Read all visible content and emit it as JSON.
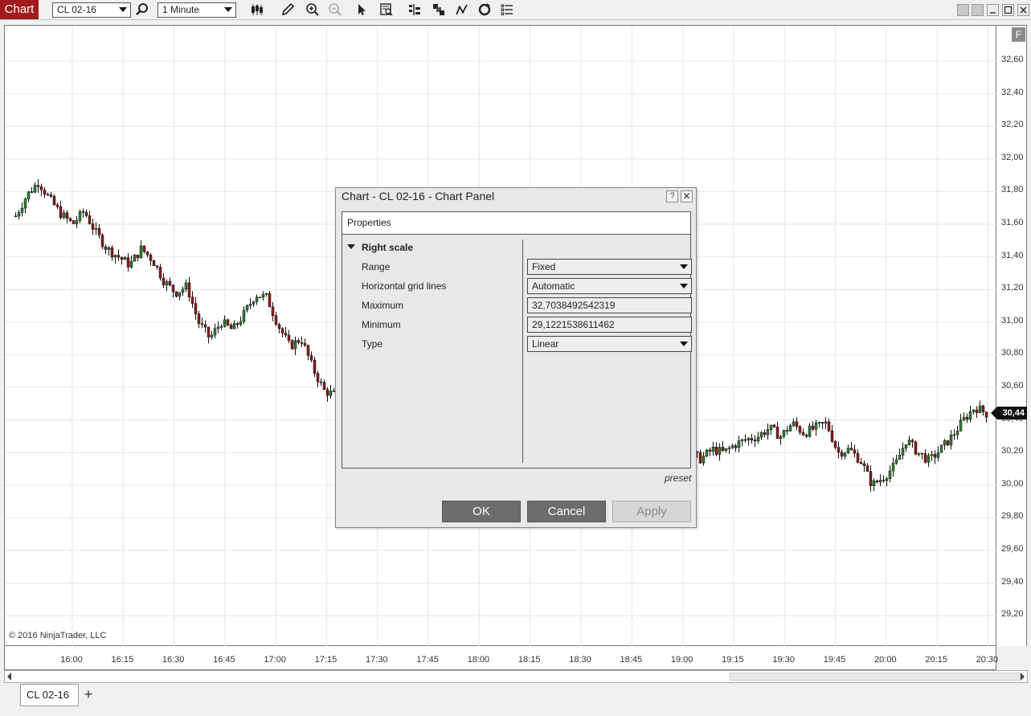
{
  "toolbar": {
    "chart_tab": "Chart",
    "instrument": "CL 02-16",
    "interval": "1 Minute"
  },
  "chart": {
    "copyright": "© 2016 NinjaTrader, LLC",
    "current_price": "30,44",
    "f_button": "F",
    "price_labels": [
      "32,60",
      "32,40",
      "32,20",
      "32,00",
      "31,80",
      "31,60",
      "31,40",
      "31,20",
      "31,00",
      "30,80",
      "30,60",
      "30,40",
      "30,20",
      "30,00",
      "29,80",
      "29,60",
      "29,40",
      "29,20"
    ],
    "time_labels": [
      "16:00",
      "16:15",
      "16:30",
      "16:45",
      "17:00",
      "17:15",
      "17:30",
      "17:45",
      "18:00",
      "18:15",
      "18:30",
      "18:45",
      "19:00",
      "19:15",
      "19:30",
      "19:45",
      "20:00",
      "20:15",
      "20:30"
    ],
    "colors": {
      "up": "#2e7d32",
      "down": "#8b1a1a",
      "wick": "#111111"
    },
    "price_path": [
      31.65,
      31.78,
      31.86,
      31.75,
      31.66,
      31.6,
      31.68,
      31.55,
      31.45,
      31.4,
      31.35,
      31.45,
      31.38,
      31.25,
      31.18,
      31.22,
      31.0,
      30.9,
      31.0,
      30.95,
      31.05,
      31.17,
      31.15,
      30.98,
      30.85,
      30.9,
      30.72,
      30.58,
      30.55,
      30.65,
      30.7,
      30.72,
      30.8,
      30.88,
      30.78,
      30.62,
      30.6,
      30.52,
      30.5,
      30.6,
      30.45,
      30.38,
      30.32,
      30.3,
      30.2,
      30.1,
      30.05,
      30.1,
      30.15,
      30.14,
      30.1,
      30.15,
      30.12,
      30.25,
      30.3,
      30.2,
      30.22,
      30.2,
      30.18,
      30.2,
      30.16,
      30.22,
      30.2,
      30.25,
      30.28,
      30.3,
      30.35,
      30.3,
      30.38,
      30.32,
      30.35,
      30.38,
      30.2,
      30.22,
      30.15,
      30.0,
      30.05,
      30.12,
      30.28,
      30.2,
      30.15,
      30.22,
      30.3,
      30.4,
      30.48,
      30.44
    ]
  },
  "bottom": {
    "tab_label": "CL 02-16",
    "add_label": "+"
  },
  "dialog": {
    "title": "Chart - CL 02-16 - Chart Panel",
    "help": "?",
    "close": "✕",
    "properties_header": "Properties",
    "section": "Right scale",
    "rows": [
      {
        "label": "Range",
        "value": "Fixed",
        "type": "select"
      },
      {
        "label": "Horizontal grid lines",
        "value": "Automatic",
        "type": "select"
      },
      {
        "label": "Maximum",
        "value": "32,7038492542319",
        "type": "input"
      },
      {
        "label": "Minimum",
        "value": "29,1221538611462",
        "type": "input"
      },
      {
        "label": "Type",
        "value": "Linear",
        "type": "select"
      }
    ],
    "preset": "preset",
    "ok": "OK",
    "cancel": "Cancel",
    "apply": "Apply"
  }
}
